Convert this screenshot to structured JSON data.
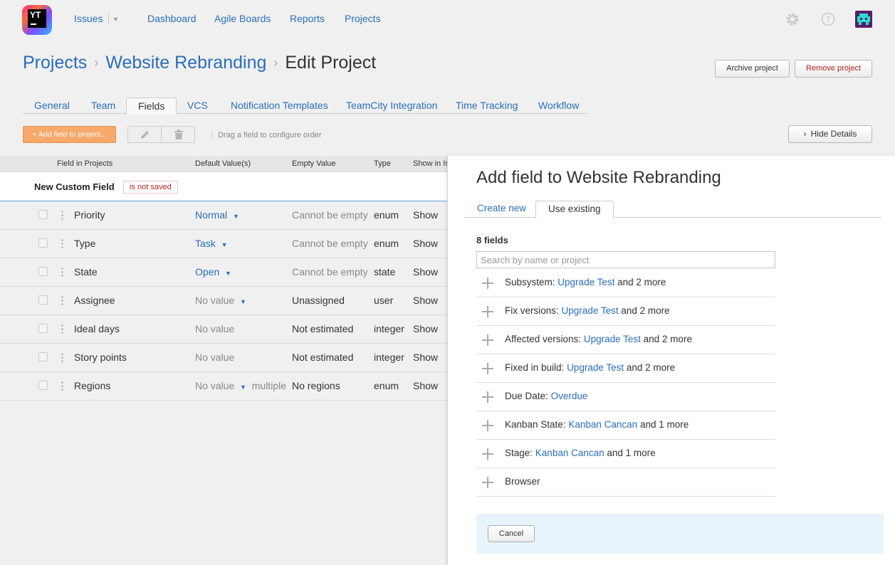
{
  "header": {
    "logo_text": "YT",
    "nav": {
      "issues": "Issues",
      "dashboard": "Dashboard",
      "agile_boards": "Agile Boards",
      "reports": "Reports",
      "projects": "Projects"
    }
  },
  "breadcrumb": {
    "projects": "Projects",
    "project": "Website Rebranding",
    "current": "Edit Project"
  },
  "actions": {
    "archive": "Archive project",
    "remove": "Remove project"
  },
  "tabs": [
    "General",
    "Team",
    "Fields",
    "VCS",
    "Notification Templates",
    "TeamCity Integration",
    "Time Tracking",
    "Workflow"
  ],
  "active_tab": "Fields",
  "toolbar": {
    "add_field": "+ Add field to project...",
    "drag_hint": "Drag a field to configure order",
    "hide_details": "Hide Details"
  },
  "table": {
    "headers": [
      "Field in Projects",
      "Default Value(s)",
      "Empty Value",
      "Type",
      "Show in Is"
    ],
    "new_field": {
      "name": "New Custom Field",
      "status": "is not saved"
    },
    "rows": [
      {
        "name": "Priority",
        "default": "Normal",
        "empty": "Cannot be empty",
        "type": "enum",
        "show": "Show"
      },
      {
        "name": "Type",
        "default": "Task",
        "empty": "Cannot be empty",
        "type": "enum",
        "show": "Show"
      },
      {
        "name": "State",
        "default": "Open",
        "empty": "Cannot be empty",
        "type": "state",
        "show": "Show"
      },
      {
        "name": "Assignee",
        "default": "No value",
        "empty": "Unassigned",
        "type": "user",
        "show": "Show"
      },
      {
        "name": "Ideal days",
        "default": "No value",
        "empty": "Not estimated",
        "type": "integer",
        "show": "Show"
      },
      {
        "name": "Story points",
        "default": "No value",
        "empty": "Not estimated",
        "type": "integer",
        "show": "Show"
      },
      {
        "name": "Regions",
        "default": "No value",
        "extra": "multiple",
        "empty": "No regions",
        "type": "enum",
        "show": "Show"
      }
    ]
  },
  "panel": {
    "title": "Add field to Website Rebranding",
    "tabs": {
      "create_new": "Create new",
      "use_existing": "Use existing"
    },
    "count": "8 fields",
    "search_placeholder": "Search by name or project",
    "fields": [
      {
        "name": "Subsystem:",
        "project": "Upgrade Test",
        "more": "and 2 more"
      },
      {
        "name": "Fix versions:",
        "project": "Upgrade Test",
        "more": "and 2 more"
      },
      {
        "name": "Affected versions:",
        "project": "Upgrade Test",
        "more": "and 2 more"
      },
      {
        "name": "Fixed in build:",
        "project": "Upgrade Test",
        "more": "and 2 more"
      },
      {
        "name": "Due Date:",
        "project": "Overdue",
        "more": ""
      },
      {
        "name": "Kanban State:",
        "project": "Kanban Cancan",
        "more": "and 1 more"
      },
      {
        "name": "Stage:",
        "project": "Kanban Cancan",
        "more": "and 1 more"
      },
      {
        "name": "Browser",
        "project": "",
        "more": ""
      }
    ],
    "cancel": "Cancel"
  }
}
